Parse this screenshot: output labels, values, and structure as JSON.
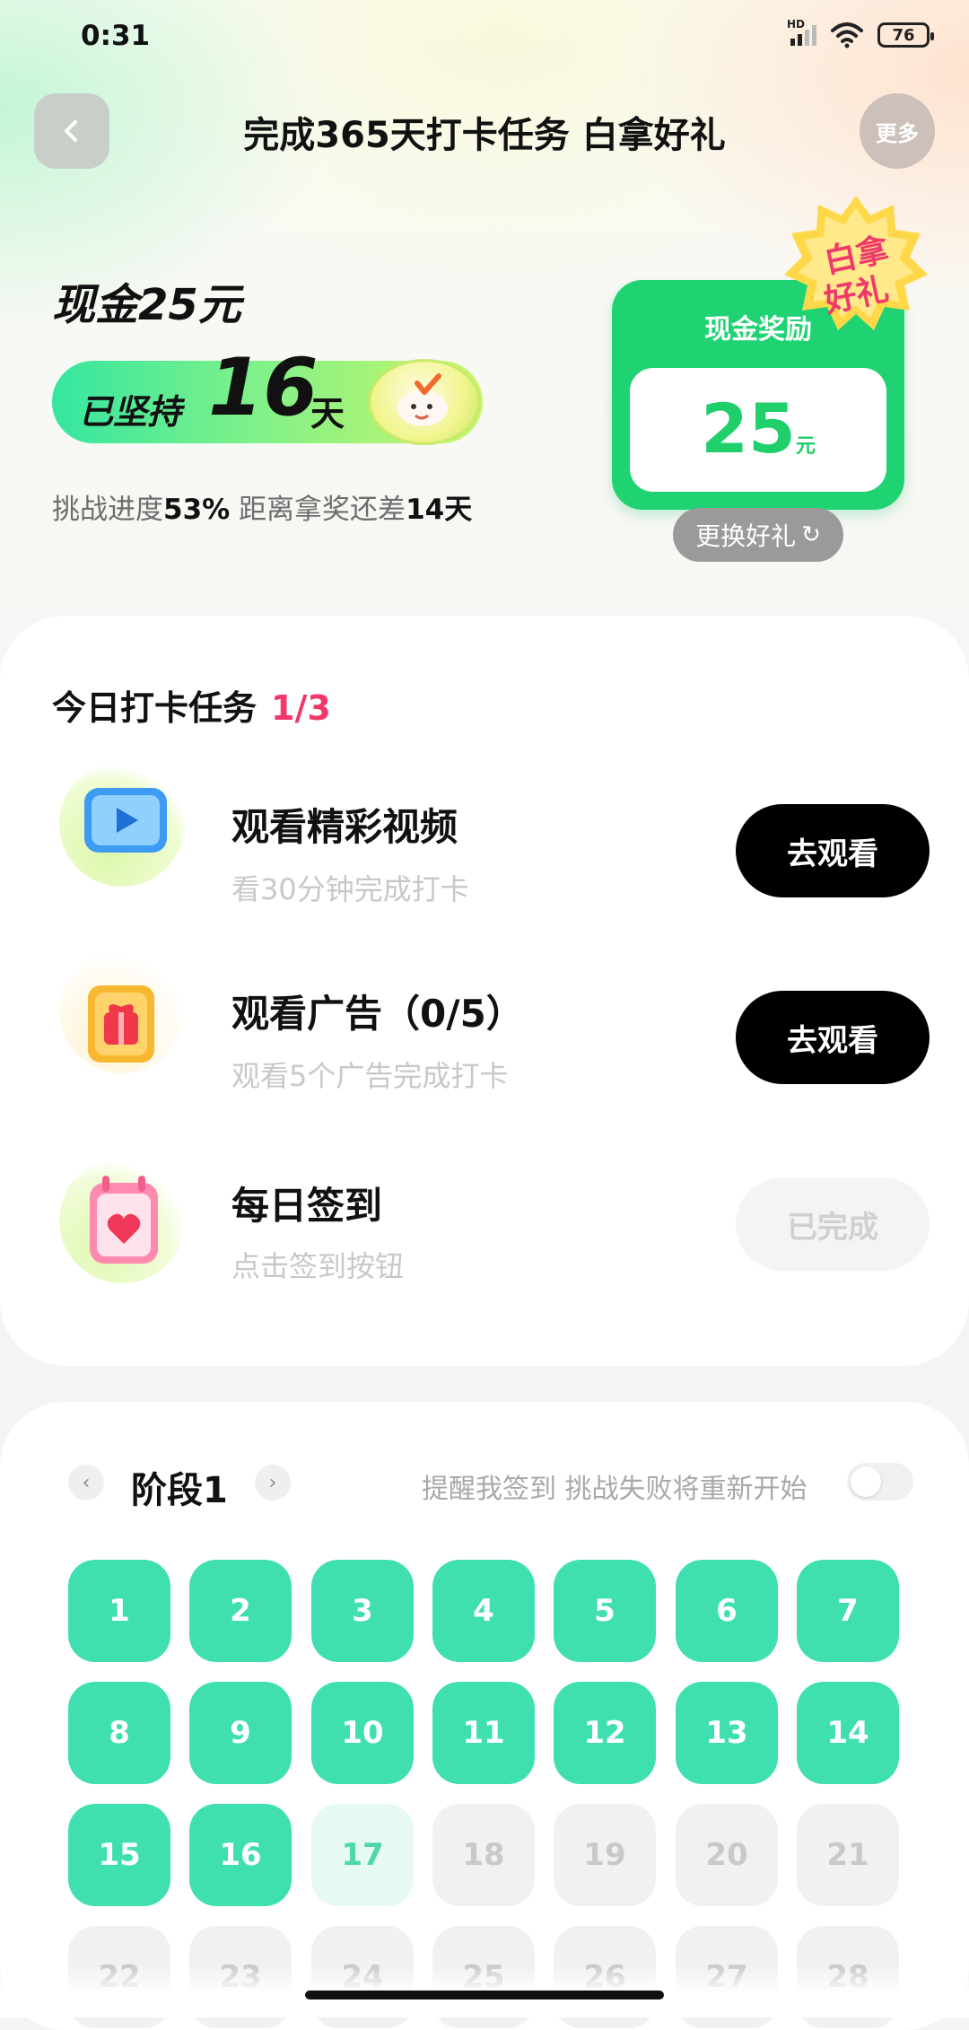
{
  "status_bar": {
    "time": "0:31",
    "network": "HD",
    "battery": "76"
  },
  "header": {
    "title": "完成365天打卡任务 白拿好礼",
    "more_label": "更多"
  },
  "hero": {
    "cash_title": "现金25元",
    "streak_prefix": "已坚持",
    "streak_days": "16",
    "streak_suffix": "天",
    "progress_prefix": "挑战进度",
    "progress_percent": "53%",
    "progress_middle": "距离拿奖还差",
    "progress_remaining": "14天"
  },
  "reward": {
    "label": "现金奖励",
    "amount": "25",
    "unit": "元",
    "badge_line1": "白拿",
    "badge_line2": "好礼",
    "change_label": "更换好礼"
  },
  "tasks": {
    "title": "今日打卡任务",
    "count": "1/3",
    "items": [
      {
        "title": "观看精彩视频",
        "subtitle": "看30分钟完成打卡",
        "button": "去观看",
        "icon": "video-play-icon"
      },
      {
        "title": "观看广告（0/5）",
        "subtitle": "观看5个广告完成打卡",
        "button": "去观看",
        "icon": "gift-box-icon"
      },
      {
        "title": "每日签到",
        "subtitle": "点击签到按钮",
        "button": "已完成",
        "icon": "heart-calendar-icon"
      }
    ]
  },
  "stage": {
    "label": "阶段1",
    "remind_text": "提醒我签到 挑战失败将重新开始",
    "days": [
      "1",
      "2",
      "3",
      "4",
      "5",
      "6",
      "7",
      "8",
      "9",
      "10",
      "11",
      "12",
      "13",
      "14",
      "15",
      "16",
      "17",
      "18",
      "19",
      "20",
      "21",
      "22",
      "23",
      "24",
      "25",
      "26",
      "27",
      "28"
    ],
    "completed_days": 16,
    "current_day": 17
  },
  "colors": {
    "accent_green": "#1fd373",
    "day_done": "#3fdfb0",
    "count_red": "#f0386a"
  }
}
